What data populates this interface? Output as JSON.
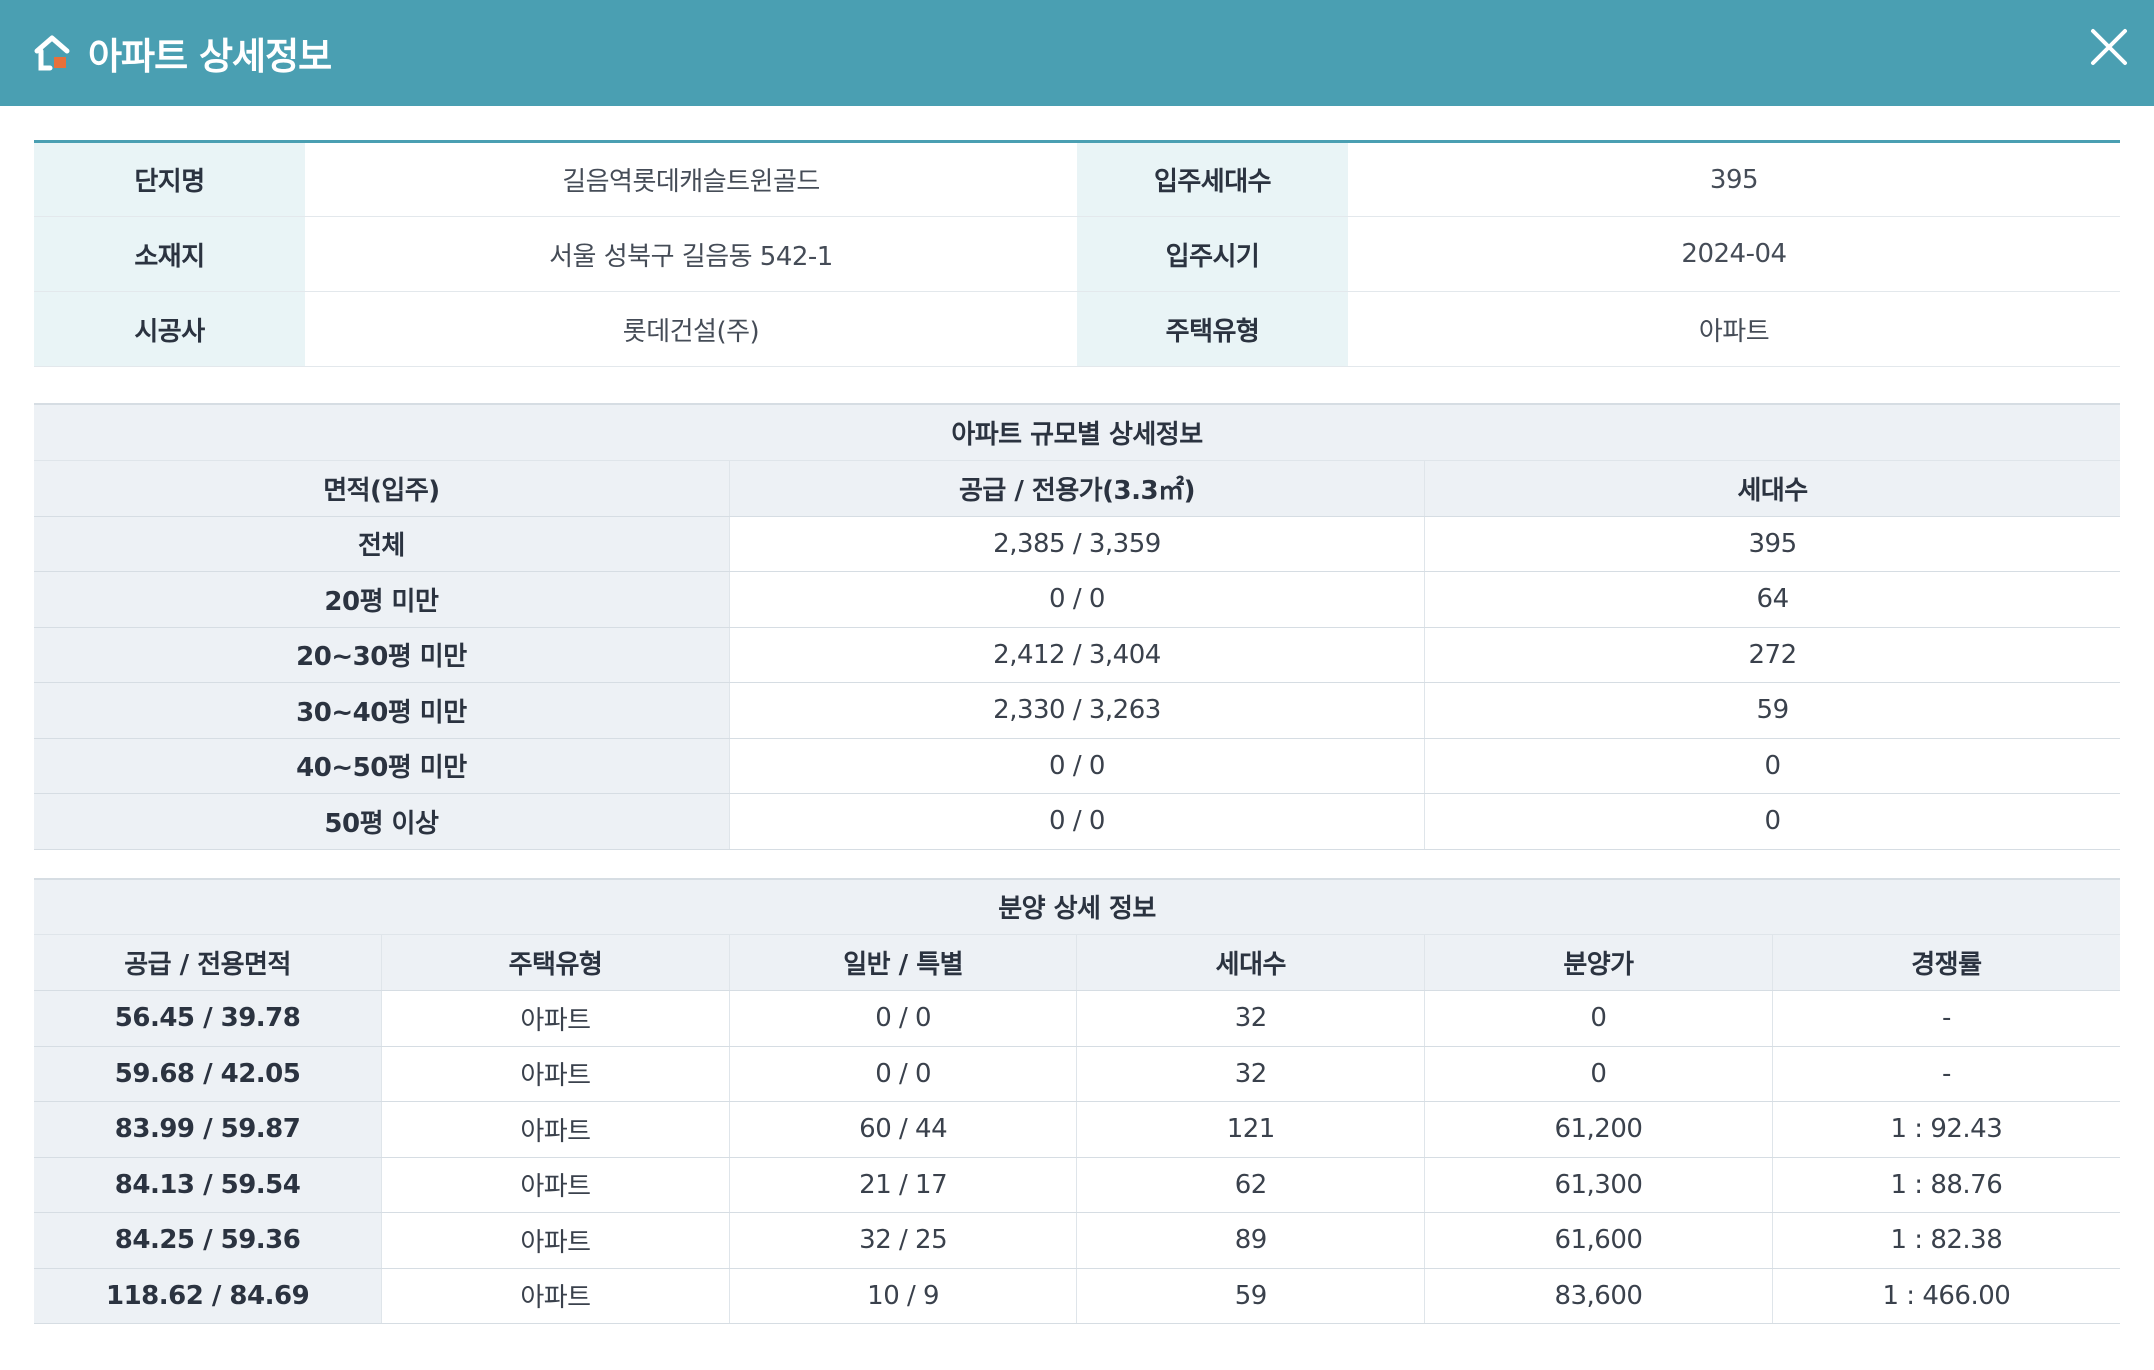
{
  "header": {
    "title": "아파트 상세정보",
    "accent_color": "#4a9fb2",
    "logo_icon": "house-icon",
    "close_icon": "close-icon"
  },
  "info": {
    "rows": [
      {
        "label1": "단지명",
        "value1": "길음역롯데캐슬트윈골드",
        "label2": "입주세대수",
        "value2": "395"
      },
      {
        "label1": "소재지",
        "value1": "서울 성북구 길음동 542-1",
        "label2": "입주시기",
        "value2": "2024-04"
      },
      {
        "label1": "시공사",
        "value1": "롯데건설(주)",
        "label2": "주택유형",
        "value2": "아파트"
      }
    ]
  },
  "size_table": {
    "caption": "아파트 규모별 상세정보",
    "headers": [
      "면적(입주)",
      "공급 / 전용가(3.3㎡)",
      "세대수"
    ],
    "rows": [
      [
        "전체",
        "2,385 / 3,359",
        "395"
      ],
      [
        "20평 미만",
        "0 / 0",
        "64"
      ],
      [
        "20~30평 미만",
        "2,412 / 3,404",
        "272"
      ],
      [
        "30~40평 미만",
        "2,330 / 3,263",
        "59"
      ],
      [
        "40~50평 미만",
        "0 / 0",
        "0"
      ],
      [
        "50평 이상",
        "0 / 0",
        "0"
      ]
    ]
  },
  "sale_table": {
    "caption": "분양 상세 정보",
    "headers": [
      "공급 / 전용면적",
      "주택유형",
      "일반 / 특별",
      "세대수",
      "분양가",
      "경쟁률"
    ],
    "rows": [
      [
        "56.45 / 39.78",
        "아파트",
        "0 / 0",
        "32",
        "0",
        "-"
      ],
      [
        "59.68 / 42.05",
        "아파트",
        "0 / 0",
        "32",
        "0",
        "-"
      ],
      [
        "83.99 / 59.87",
        "아파트",
        "60 / 44",
        "121",
        "61,200",
        "1 : 92.43"
      ],
      [
        "84.13 / 59.54",
        "아파트",
        "21 / 17",
        "62",
        "61,300",
        "1 : 88.76"
      ],
      [
        "84.25 / 59.36",
        "아파트",
        "32 / 25",
        "89",
        "61,600",
        "1 : 82.38"
      ],
      [
        "118.62 / 84.69",
        "아파트",
        "10 / 9",
        "59",
        "83,600",
        "1 : 466.00"
      ]
    ]
  }
}
